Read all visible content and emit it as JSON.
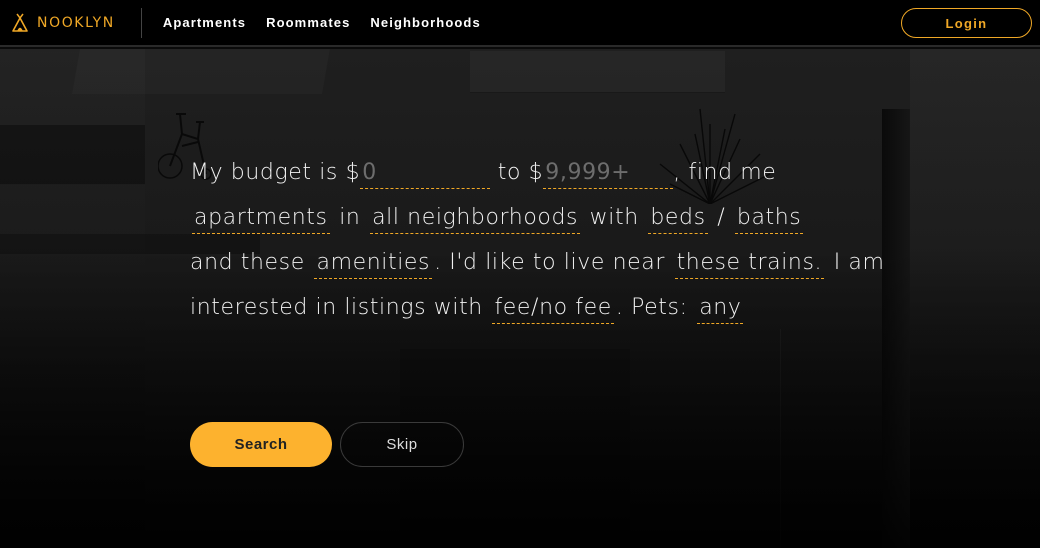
{
  "brand": {
    "name": "NOOKLYN",
    "icon": "teepee-icon",
    "accent_color": "#f0a826"
  },
  "nav": {
    "links": [
      {
        "label": "Apartments"
      },
      {
        "label": "Roommates"
      },
      {
        "label": "Neighborhoods"
      }
    ],
    "login_label": "Login"
  },
  "search_form": {
    "part1": "My budget is $",
    "min_price": {
      "value": "",
      "placeholder": "0"
    },
    "part2": "to $",
    "max_price": {
      "value": "",
      "placeholder": "9,999+"
    },
    "part3": ", find me",
    "listing_type": "apartments",
    "part4": "in",
    "neighborhoods": "all neighborhoods",
    "part5": "with",
    "beds": "beds",
    "slash": "/",
    "baths": "baths",
    "part6": "and these",
    "amenities": "amenities",
    "part7": ". I'd like to live near",
    "trains": "these trains.",
    "part8": "I am interested in listings with",
    "fee": "fee/no fee",
    "part9": ". Pets:",
    "pets": "any"
  },
  "actions": {
    "search_label": "Search",
    "skip_label": "Skip",
    "search_color": "#fdb22e"
  }
}
